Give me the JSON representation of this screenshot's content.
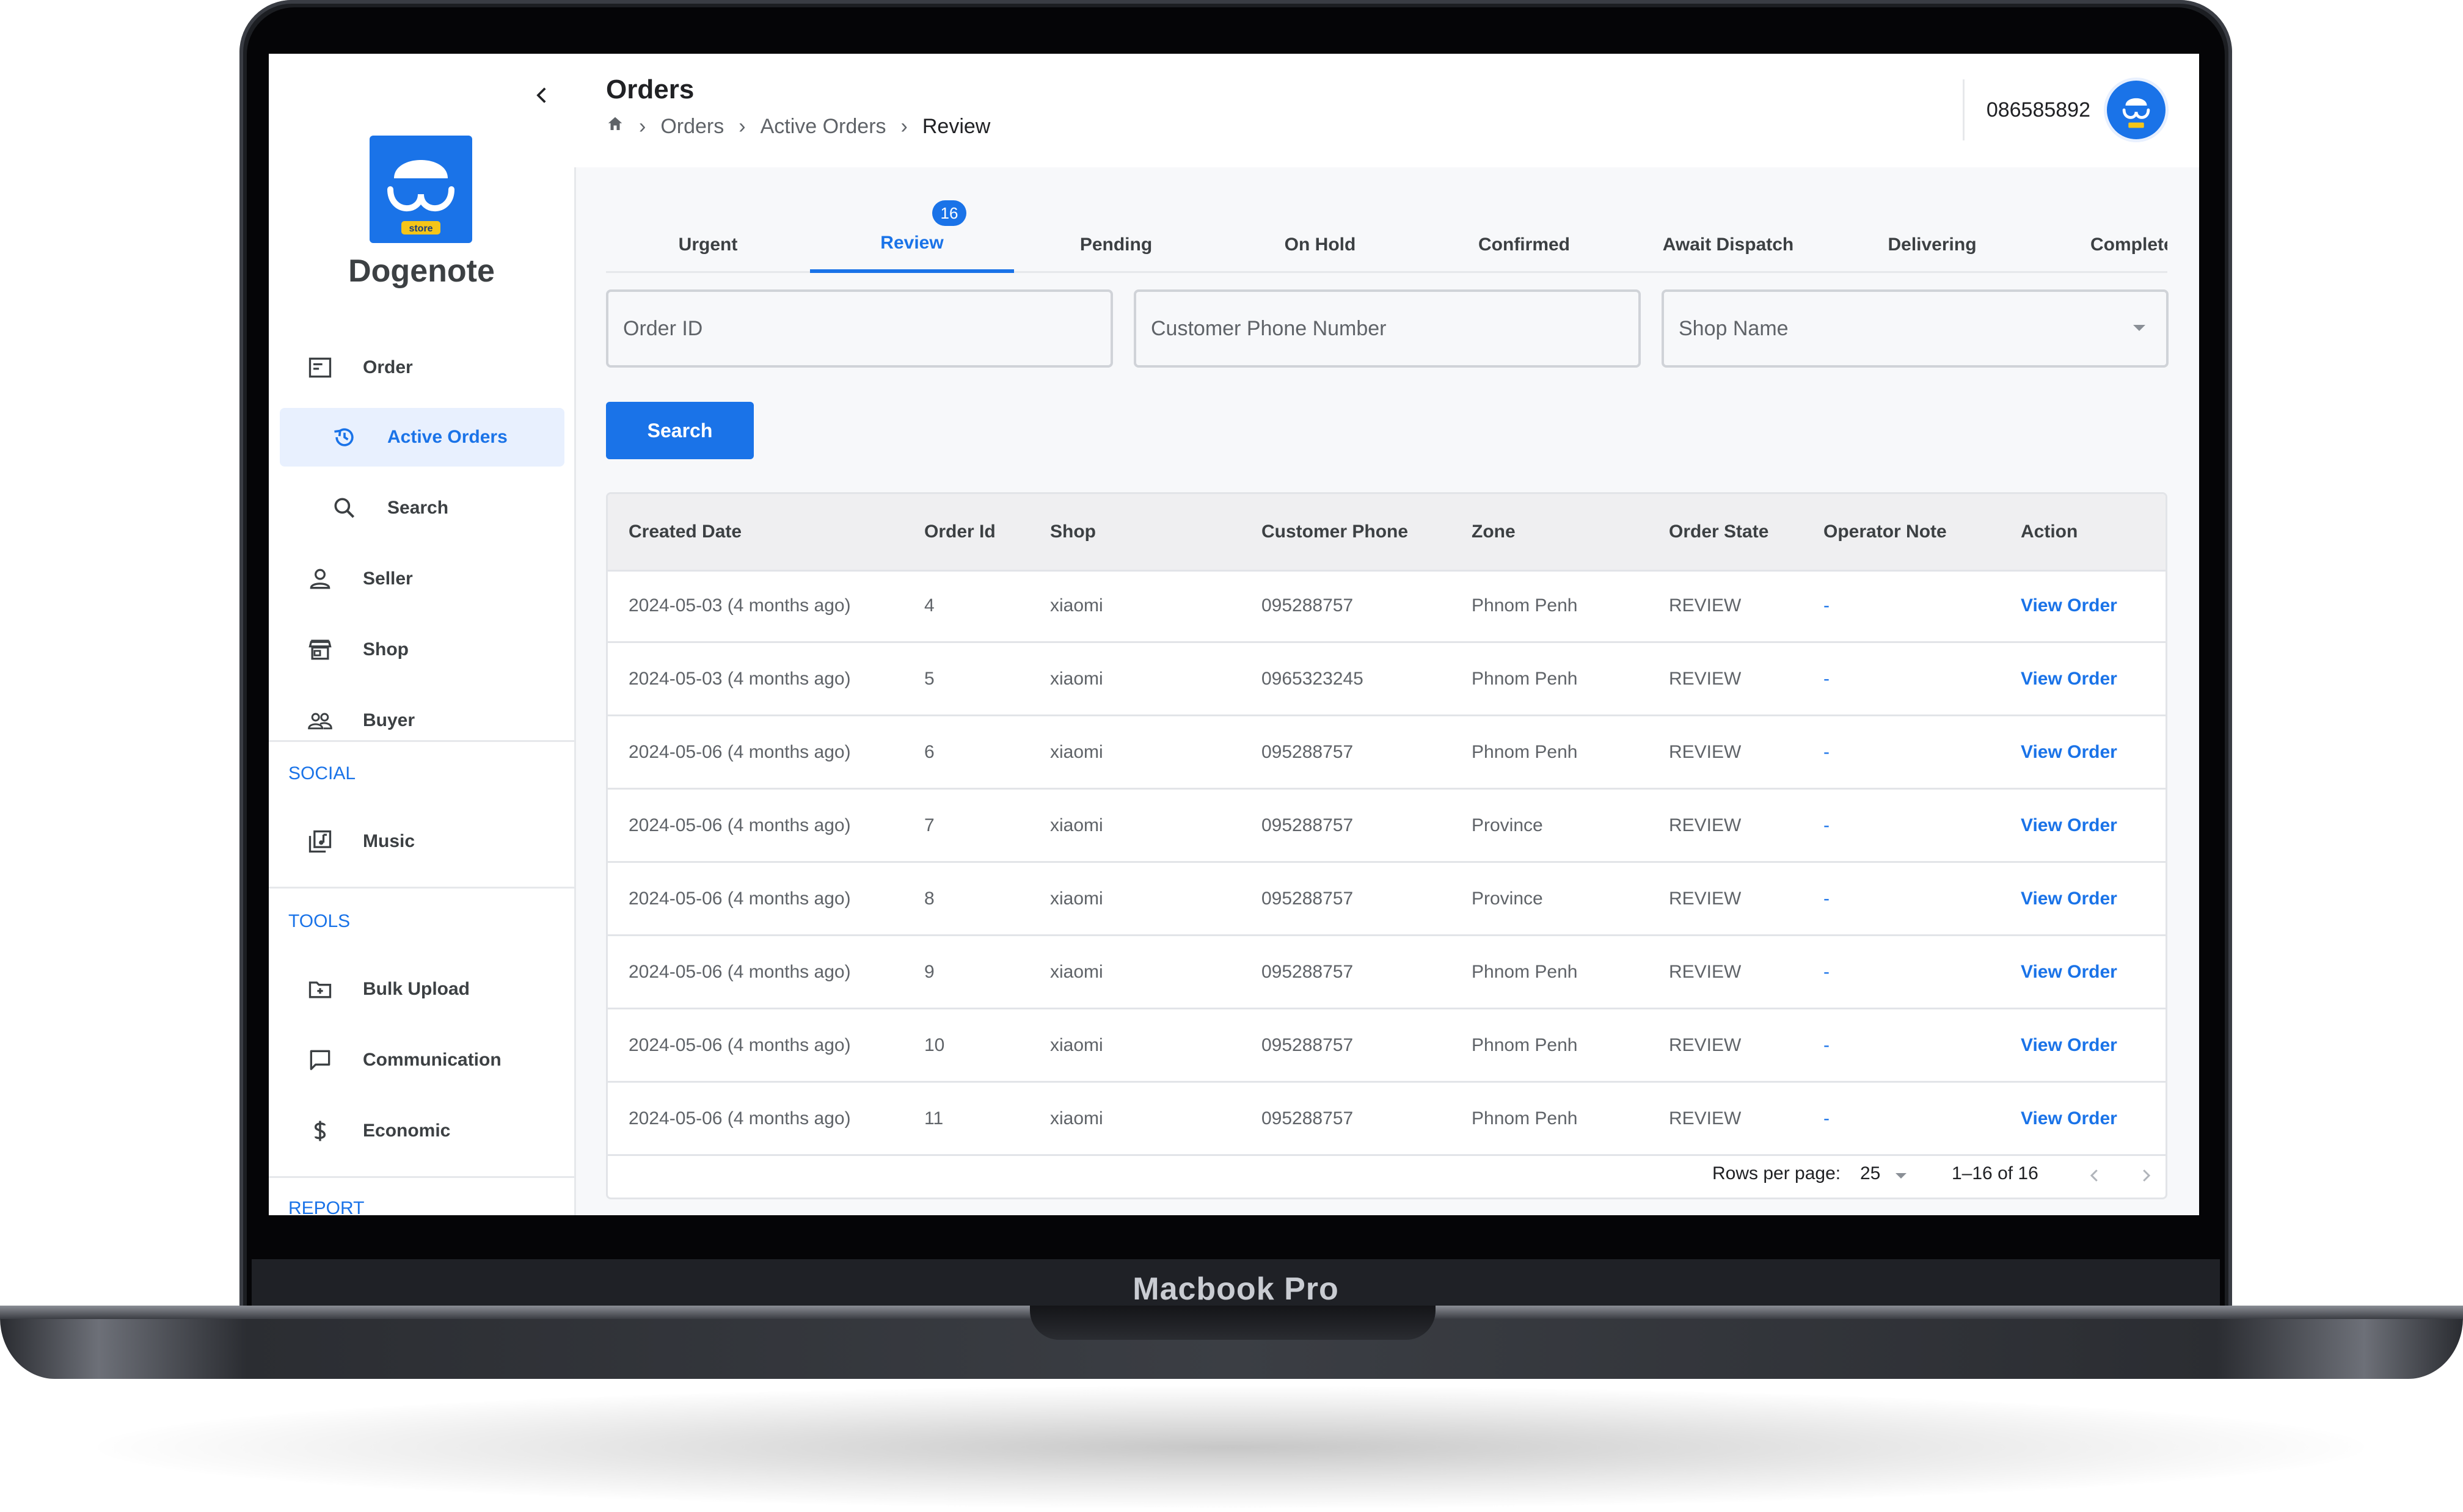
{
  "device": {
    "label": "Macbook Pro"
  },
  "sidebar": {
    "app_name": "Dogenote",
    "logo_badge": "store",
    "items": [
      {
        "label": "Order",
        "icon": "order-icon"
      },
      {
        "label": "Active Orders",
        "icon": "history-icon",
        "active": true
      },
      {
        "label": "Search",
        "icon": "search-icon"
      },
      {
        "label": "Seller",
        "icon": "person-icon"
      },
      {
        "label": "Shop",
        "icon": "store-icon"
      },
      {
        "label": "Buyer",
        "icon": "people-icon"
      }
    ],
    "sections": {
      "social": {
        "label": "SOCIAL",
        "items": [
          {
            "label": "Music",
            "icon": "music-library-icon"
          }
        ]
      },
      "tools": {
        "label": "TOOLS",
        "items": [
          {
            "label": "Bulk Upload",
            "icon": "folder-plus-icon"
          },
          {
            "label": "Communication",
            "icon": "chat-icon"
          },
          {
            "label": "Economic",
            "icon": "dollar-icon"
          }
        ]
      },
      "report": {
        "label": "REPORT"
      }
    }
  },
  "header": {
    "title": "Orders",
    "breadcrumb": [
      "Orders",
      "Active Orders",
      "Review"
    ],
    "user_phone": "086585892"
  },
  "tabs": [
    {
      "label": "Urgent"
    },
    {
      "label": "Review",
      "badge": "16",
      "active": true
    },
    {
      "label": "Pending"
    },
    {
      "label": "On Hold"
    },
    {
      "label": "Confirmed"
    },
    {
      "label": "Await Dispatch"
    },
    {
      "label": "Delivering"
    },
    {
      "label": "Complete"
    }
  ],
  "filters": {
    "order_id_placeholder": "Order ID",
    "customer_phone_placeholder": "Customer Phone Number",
    "shop_name_placeholder": "Shop Name",
    "search_label": "Search"
  },
  "table": {
    "columns": [
      "Created Date",
      "Order Id",
      "Shop",
      "Customer Phone",
      "Zone",
      "Order State",
      "Operator Note",
      "Action"
    ],
    "rows": [
      [
        "2024-05-03 (4 months ago)",
        "4",
        "xiaomi",
        "095288757",
        "Phnom Penh",
        "REVIEW",
        "-",
        "View Order"
      ],
      [
        "2024-05-03 (4 months ago)",
        "5",
        "xiaomi",
        "0965323245",
        "Phnom Penh",
        "REVIEW",
        "-",
        "View Order"
      ],
      [
        "2024-05-06 (4 months ago)",
        "6",
        "xiaomi",
        "095288757",
        "Phnom Penh",
        "REVIEW",
        "-",
        "View Order"
      ],
      [
        "2024-05-06 (4 months ago)",
        "7",
        "xiaomi",
        "095288757",
        "Province",
        "REVIEW",
        "-",
        "View Order"
      ],
      [
        "2024-05-06 (4 months ago)",
        "8",
        "xiaomi",
        "095288757",
        "Province",
        "REVIEW",
        "-",
        "View Order"
      ],
      [
        "2024-05-06 (4 months ago)",
        "9",
        "xiaomi",
        "095288757",
        "Phnom Penh",
        "REVIEW",
        "-",
        "View Order"
      ],
      [
        "2024-05-06 (4 months ago)",
        "10",
        "xiaomi",
        "095288757",
        "Phnom Penh",
        "REVIEW",
        "-",
        "View Order"
      ],
      [
        "2024-05-06 (4 months ago)",
        "11",
        "xiaomi",
        "095288757",
        "Phnom Penh",
        "REVIEW",
        "-",
        "View Order"
      ]
    ],
    "pagination": {
      "rows_per_page_label": "Rows per page:",
      "rows_per_page": "25",
      "range": "1–16 of 16"
    }
  },
  "colors": {
    "accent": "#1a73e8",
    "active_bg": "#e8f0fe",
    "header_bg": "#efeff1"
  }
}
